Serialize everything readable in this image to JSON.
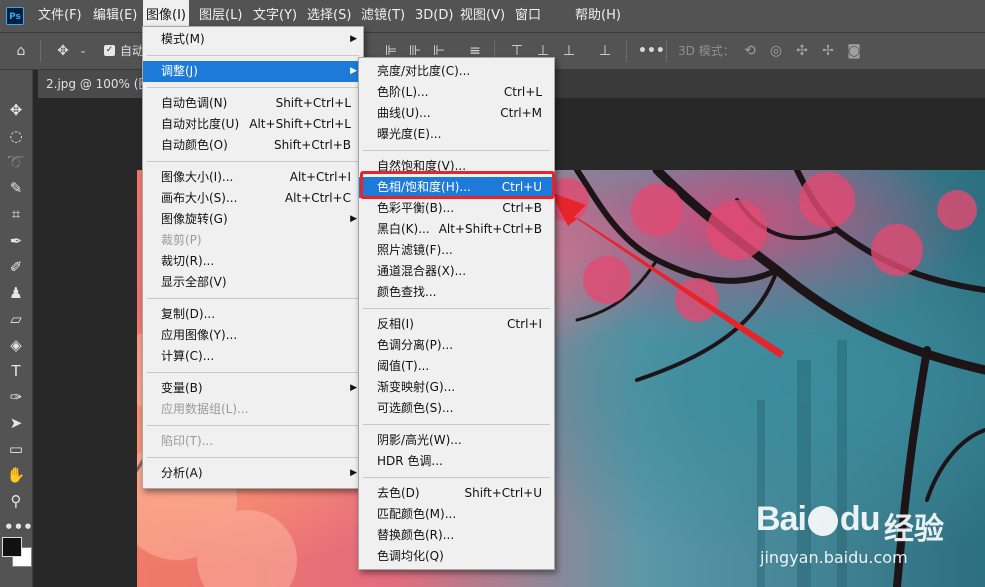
{
  "app": {
    "logo": "Ps"
  },
  "menubar": {
    "items": [
      "文件(F)",
      "编辑(E)",
      "图像(I)",
      "图层(L)",
      "文字(Y)",
      "选择(S)",
      "滤镜(T)",
      "3D(D)",
      "视图(V)",
      "窗口",
      "帮助(H)"
    ]
  },
  "options": {
    "auto_select_label": "自动",
    "mode3d_label": "3D 模式："
  },
  "tab": {
    "title": "2.jpg @ 100% (图"
  },
  "image_menu": {
    "items": [
      {
        "label": "模式(M)",
        "shortcut": "",
        "submenu": true
      },
      {
        "label": "调整(J)",
        "shortcut": "",
        "submenu": true,
        "highlighted": true
      },
      {
        "label": "自动色调(N)",
        "shortcut": "Shift+Ctrl+L"
      },
      {
        "label": "自动对比度(U)",
        "shortcut": "Alt+Shift+Ctrl+L"
      },
      {
        "label": "自动颜色(O)",
        "shortcut": "Shift+Ctrl+B"
      },
      {
        "label": "图像大小(I)...",
        "shortcut": "Alt+Ctrl+I"
      },
      {
        "label": "画布大小(S)...",
        "shortcut": "Alt+Ctrl+C"
      },
      {
        "label": "图像旋转(G)",
        "shortcut": "",
        "submenu": true
      },
      {
        "label": "裁剪(P)",
        "shortcut": "",
        "disabled": true
      },
      {
        "label": "裁切(R)...",
        "shortcut": ""
      },
      {
        "label": "显示全部(V)",
        "shortcut": ""
      },
      {
        "label": "复制(D)...",
        "shortcut": ""
      },
      {
        "label": "应用图像(Y)...",
        "shortcut": ""
      },
      {
        "label": "计算(C)...",
        "shortcut": ""
      },
      {
        "label": "变量(B)",
        "shortcut": "",
        "submenu": true
      },
      {
        "label": "应用数据组(L)...",
        "shortcut": "",
        "disabled": true
      },
      {
        "label": "陷印(T)...",
        "shortcut": "",
        "disabled": true
      },
      {
        "label": "分析(A)",
        "shortcut": "",
        "submenu": true
      }
    ]
  },
  "adjust_menu": {
    "items": [
      {
        "label": "亮度/对比度(C)...",
        "shortcut": ""
      },
      {
        "label": "色阶(L)...",
        "shortcut": "Ctrl+L"
      },
      {
        "label": "曲线(U)...",
        "shortcut": "Ctrl+M"
      },
      {
        "label": "曝光度(E)...",
        "shortcut": ""
      },
      {
        "label": "自然饱和度(V)...",
        "shortcut": ""
      },
      {
        "label": "色相/饱和度(H)...",
        "shortcut": "Ctrl+U",
        "highlighted": true
      },
      {
        "label": "色彩平衡(B)...",
        "shortcut": "Ctrl+B"
      },
      {
        "label": "黑白(K)...",
        "shortcut": "Alt+Shift+Ctrl+B"
      },
      {
        "label": "照片滤镜(F)...",
        "shortcut": ""
      },
      {
        "label": "通道混合器(X)...",
        "shortcut": ""
      },
      {
        "label": "颜色查找...",
        "shortcut": ""
      },
      {
        "label": "反相(I)",
        "shortcut": "Ctrl+I"
      },
      {
        "label": "色调分离(P)...",
        "shortcut": ""
      },
      {
        "label": "阈值(T)...",
        "shortcut": ""
      },
      {
        "label": "渐变映射(G)...",
        "shortcut": ""
      },
      {
        "label": "可选颜色(S)...",
        "shortcut": ""
      },
      {
        "label": "阴影/高光(W)...",
        "shortcut": ""
      },
      {
        "label": "HDR 色调...",
        "shortcut": ""
      },
      {
        "label": "去色(D)",
        "shortcut": "Shift+Ctrl+U"
      },
      {
        "label": "匹配颜色(M)...",
        "shortcut": ""
      },
      {
        "label": "替换颜色(R)...",
        "shortcut": ""
      },
      {
        "label": "色调均化(Q)",
        "shortcut": ""
      }
    ]
  },
  "watermark": {
    "brand": "Bai",
    "brand2": "du",
    "cn": "经验",
    "url": "jingyan.baidu.com"
  },
  "colors": {
    "highlight": "#1d7ad9",
    "annotation": "#e8242b",
    "menu_bg": "#f0f0f0",
    "chrome": "#535353"
  }
}
